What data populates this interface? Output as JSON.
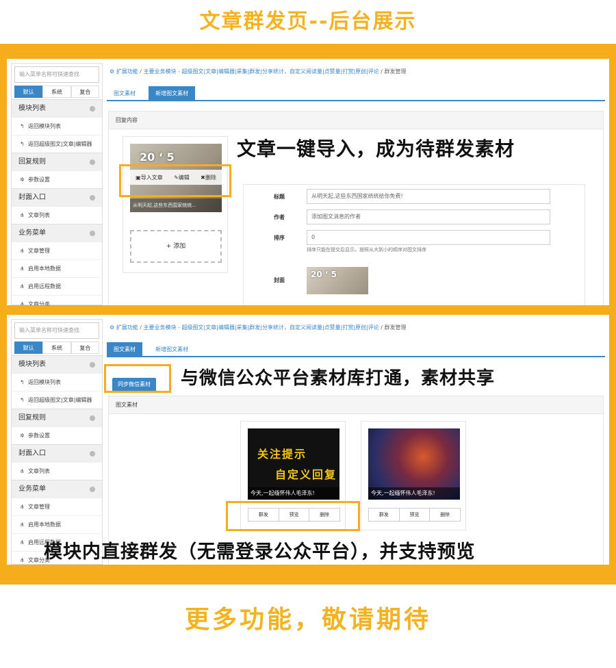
{
  "top_title": "文章群发页--后台展示",
  "bottom_title": "更多功能，敬请期待",
  "sidebar": {
    "search_placeholder": "输入菜单名称可快速查找",
    "tabs": [
      "默认",
      "系统",
      "复合"
    ],
    "groups": [
      {
        "label": "模块列表",
        "items": [
          "返回模块列表",
          "返回超级图文|文章|编辑器"
        ]
      },
      {
        "label": "回复规则",
        "items": [
          "参数设置"
        ]
      },
      {
        "label": "封面入口",
        "items": [
          "文章列表"
        ]
      },
      {
        "label": "业务菜单",
        "items": [
          "文章管理",
          "启用本地数据",
          "启用远程数据",
          "文章分类"
        ]
      }
    ]
  },
  "breadcrumb": {
    "root": "扩展功能",
    "module": "主要业务模块 - 超级图文|文章|编辑器|采集|群发|分享统计，自定义阅读量|点赞量|打赏|原创|评论",
    "current": "群发管理"
  },
  "screen1": {
    "tabs": [
      "图文素材",
      "新增图文素材"
    ],
    "panel_head": "回复内容",
    "card_caption": "从明天起,这些东西国家统统...",
    "cake_text": "20 ‘ 5",
    "actions": {
      "import": "导入文章",
      "edit": "编辑",
      "delete": "删除"
    },
    "add_label": "添加",
    "form": {
      "title_label": "标题",
      "title_value": "从明天起,这些东西国家统统给你免费!",
      "author_label": "作者",
      "author_placeholder": "添加图文消息的作者",
      "order_label": "排序",
      "order_value": "0",
      "order_help": "排序只能在提交后显示。按照从大到小的顺序对图文排序",
      "cover_label": "封面"
    },
    "overlay": "文章一键导入，成为待群发素材"
  },
  "screen2": {
    "tabs": [
      "图文素材",
      "新增图文素材"
    ],
    "sync_button": "同步微信素材",
    "overlay_sync": "与微信公众平台素材库打通，素材共享",
    "panel_head": "图文素材",
    "cards": [
      {
        "line1": "关注提示",
        "line2": "自定义回复",
        "caption": "今天,一起缅怀伟人毛泽东!"
      },
      {
        "caption": "今天,一起缅怀伟人毛泽东!"
      }
    ],
    "buttons": [
      "群发",
      "预览",
      "删除"
    ],
    "overlay_bottom": "模块内直接群发（无需登录公众平台），并支持预览"
  },
  "colors": {
    "accent": "#f5ad1c",
    "primary": "#3a87c8"
  }
}
